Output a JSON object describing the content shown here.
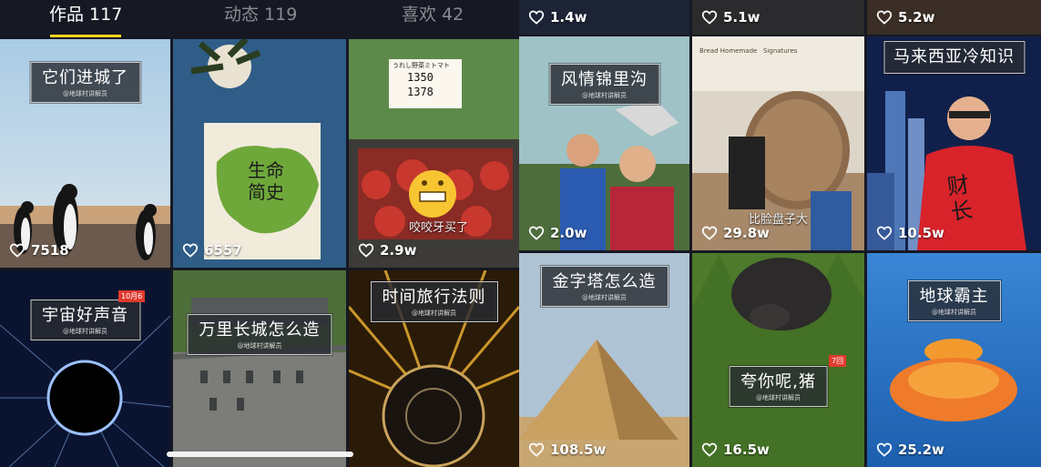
{
  "tabs": [
    {
      "label": "作品 117",
      "active": true
    },
    {
      "label": "动态 119",
      "active": false
    },
    {
      "label": "喜欢 42",
      "active": false
    }
  ],
  "left_grid": [
    {
      "caption": "它们进城了",
      "subcaption": "@地球村讲解员",
      "likes": "7518"
    },
    {
      "caption": "",
      "subcaption": "",
      "likes": "6557",
      "book_title": "生命\n简史",
      "book_label": "生命简史"
    },
    {
      "caption": "",
      "subcaption": "",
      "likes": "2.9w",
      "overlay": "咬咬牙买了",
      "price_tag": "1350\n1378",
      "label_sticker": "うれし野菜ミトマト"
    },
    {
      "caption": "宇宙好声音",
      "subcaption": "@地球村讲解员",
      "likes": "",
      "badge": "10月6"
    },
    {
      "caption": "万里长城怎么造",
      "subcaption": "@地球村讲解员",
      "likes": ""
    },
    {
      "caption": "时间旅行法则",
      "subcaption": "@地球村讲解员",
      "likes": ""
    }
  ],
  "right_top_likes": [
    "1.4w",
    "5.1w",
    "5.2w"
  ],
  "right_grid": [
    {
      "caption": "风情锦里沟",
      "subcaption": "@地球村讲解员",
      "likes": "2.0w"
    },
    {
      "caption": "",
      "subcaption": "",
      "likes": "29.8w",
      "overlay": "比脸盘子大",
      "shop_sign_1": "Bread Homemade",
      "shop_sign_2": "Signatures"
    },
    {
      "caption": "马来西亚冷知识",
      "subcaption": "",
      "likes": "10.5w",
      "shirt_text": "财\n长"
    },
    {
      "caption": "金字塔怎么造",
      "subcaption": "@地球村讲解员",
      "likes": "108.5w"
    },
    {
      "caption": "夸你呢,猪",
      "subcaption": "@地球村讲解员",
      "likes": "16.5w",
      "badge": "7回"
    },
    {
      "caption": "地球霸主",
      "subcaption": "@地球村讲解员",
      "likes": "25.2w"
    }
  ],
  "colors": {
    "accent": "#fdd31a",
    "tab_bg": "#161823",
    "tab_inactive": "#8a8b91"
  },
  "icons": {
    "like": "heart-outline-icon"
  }
}
